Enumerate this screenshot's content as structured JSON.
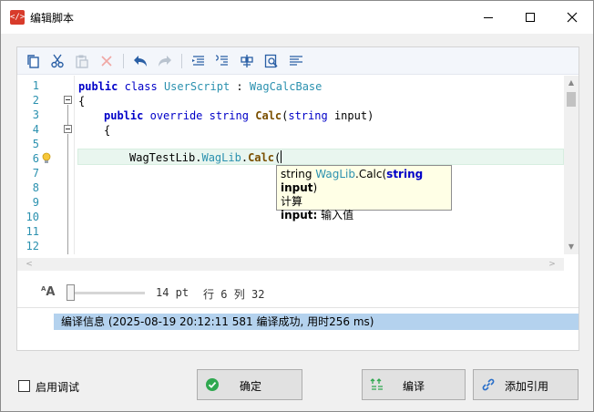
{
  "window": {
    "title": "编辑脚本",
    "colors": {
      "accent": "#d83b2b",
      "selection": "#b4d2ee",
      "keyword": "#0000c8",
      "type": "#2b91af"
    }
  },
  "toolbar": {
    "icons": [
      "copy-icon",
      "cut-icon",
      "paste-icon",
      "delete-icon",
      "undo-icon",
      "redo-icon",
      "indent-icon",
      "outdent-icon",
      "format-icon",
      "find-icon",
      "align-icon"
    ]
  },
  "editor": {
    "line_numbers": [
      "1",
      "2",
      "3",
      "4",
      "5",
      "6",
      "7",
      "8",
      "9",
      "10",
      "11",
      "12"
    ],
    "line1": {
      "kw1": "public",
      "kw2": "class",
      "name": "UserScript",
      "sep": " : ",
      "base": "WagCalcBase"
    },
    "line2": {
      "text": "{"
    },
    "line3": {
      "kw1": "public",
      "kw2": "override",
      "kw3": "string",
      "method": "Calc",
      "open": "(",
      "ptype": "string",
      "pname": " input",
      "close": ")"
    },
    "line4": {
      "text": "{"
    },
    "line6": {
      "ns": "WagTestLib",
      "dot1": ".",
      "cls": "WagLib",
      "dot2": ".",
      "method": "Calc",
      "paren": "("
    }
  },
  "tooltip": {
    "ret": "string",
    "cls": "WagLib",
    "sig_rest": ".Calc(",
    "ptype": "string",
    "pname": "input",
    "end": ")",
    "desc": "计算",
    "param_name": "input:",
    "param_desc": " 输入值"
  },
  "status": {
    "font_icon": "A",
    "font_size_value": 14,
    "font_size": "14 pt",
    "row_label": "行",
    "row": "6",
    "col_label": "列",
    "col": "32"
  },
  "output": {
    "message": "编译信息 (2025-08-19 20:12:11 581 编译成功, 用时256 ms)"
  },
  "footer": {
    "debug_label": "启用调试",
    "debug_checked": false,
    "ok_label": "确定",
    "compile_label": "编译",
    "add_ref_label": "添加引用"
  }
}
